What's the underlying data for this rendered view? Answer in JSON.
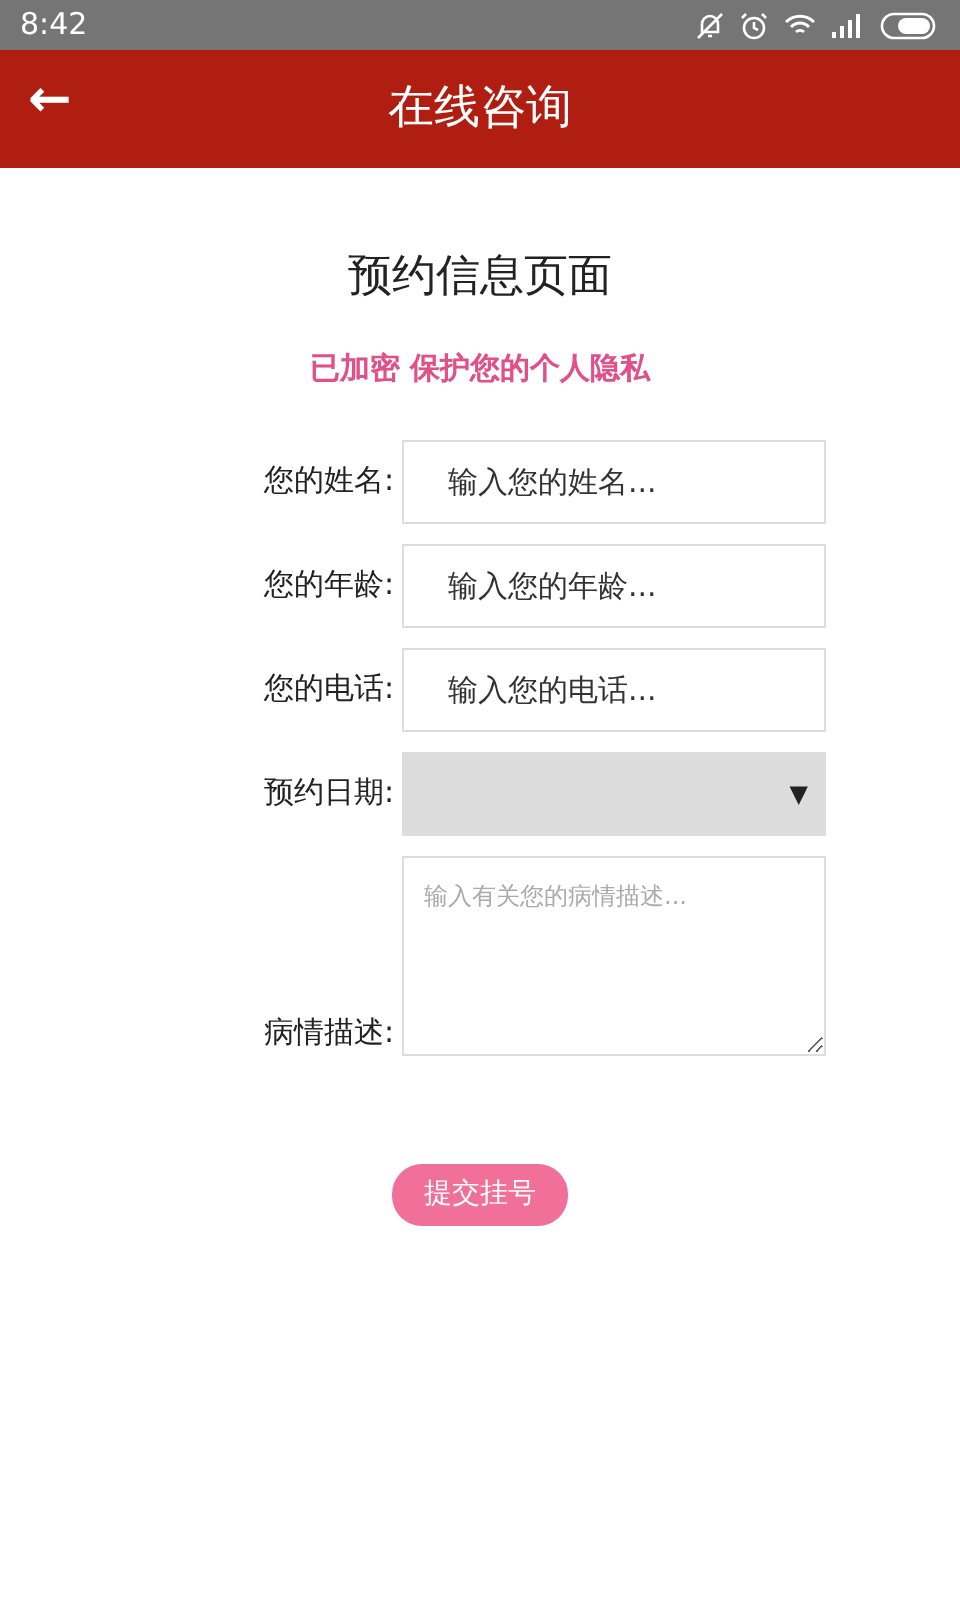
{
  "status_bar": {
    "time": "8:42"
  },
  "header": {
    "back": "←",
    "title": "在线咨询"
  },
  "page_title": "预约信息页面",
  "notice": "已加密 保护您的个人隐私",
  "fields": [
    {
      "kind": "text",
      "label": "您的姓名:",
      "placeholder": "输入您的姓名..."
    },
    {
      "kind": "text",
      "label": "您的年龄:",
      "placeholder": "输入您的年龄..."
    },
    {
      "kind": "text",
      "label": "您的电话:",
      "placeholder": "输入您的电话..."
    },
    {
      "kind": "select",
      "label": "预约日期:",
      "caret": "▼"
    },
    {
      "kind": "textarea",
      "label": "病情描述:",
      "placeholder": "输入有关您的病情描述..."
    }
  ],
  "submit": "提交挂号"
}
